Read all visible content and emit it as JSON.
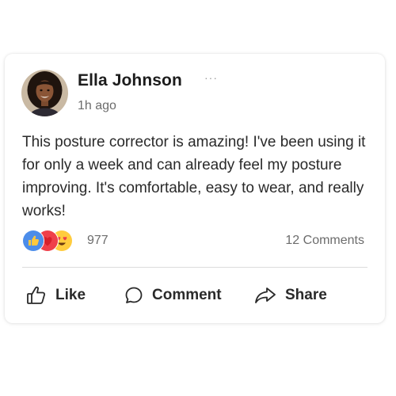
{
  "post": {
    "author_name": "Ella Johnson",
    "more_label": "···",
    "timestamp": "1h ago",
    "text": "This posture corrector is amazing! I've been using it for only a week and can already feel my posture improving. It's comfortable, easy to wear, and really works!",
    "reaction_icons": [
      "like-reaction-icon",
      "love-reaction-icon",
      "heart-eyes-reaction-icon"
    ],
    "reaction_count": "977",
    "comments_count": "12 Comments"
  },
  "actions": {
    "like_label": "Like",
    "comment_label": "Comment",
    "share_label": "Share"
  },
  "colors": {
    "like_blue": "#4c8dea",
    "love_red": "#ef3f4a",
    "emoji_yellow": "#ffcc3e",
    "text_dark": "#1c1c1c",
    "text_muted": "#6c6c6c",
    "divider": "#dcdcdc"
  }
}
